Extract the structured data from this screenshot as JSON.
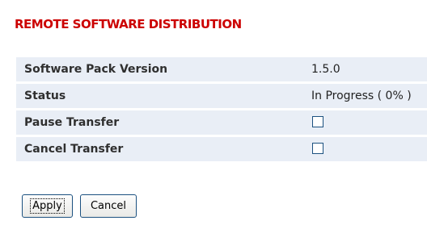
{
  "title": "REMOTE SOFTWARE DISTRIBUTION",
  "rows": [
    {
      "label": "Software Pack Version",
      "value": "1.5.0"
    },
    {
      "label": "Status",
      "value": "In Progress ( 0% )"
    },
    {
      "label": "Pause Transfer",
      "checked": false
    },
    {
      "label": "Cancel Transfer",
      "checked": false
    }
  ],
  "buttons": {
    "apply": "Apply",
    "cancel": "Cancel"
  }
}
